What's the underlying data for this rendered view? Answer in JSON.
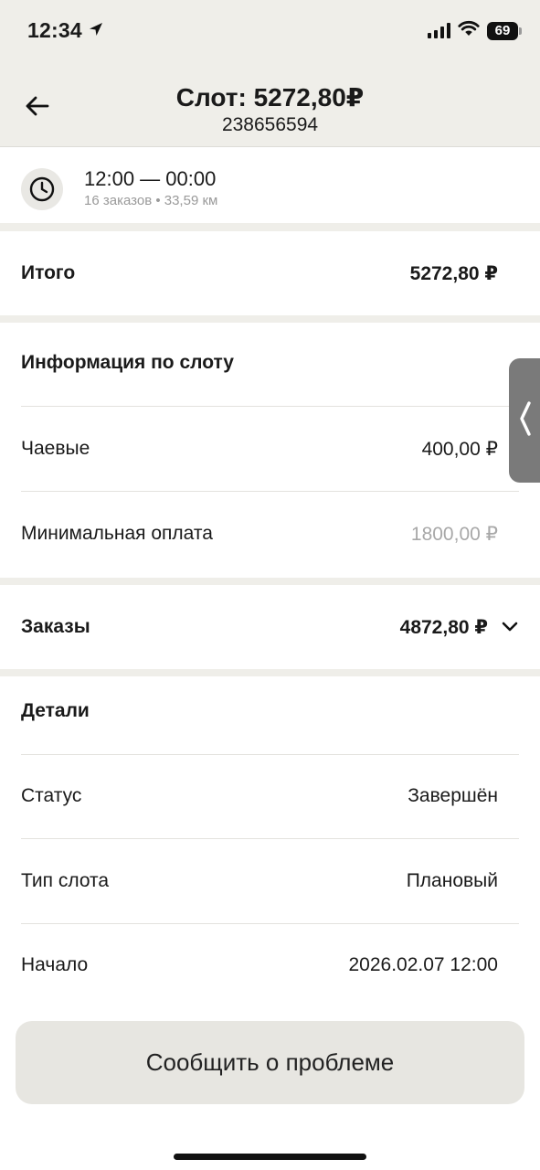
{
  "status_bar": {
    "time": "12:34",
    "battery": "69"
  },
  "header": {
    "title": "Слот: 5272,80₽",
    "subtitle": "238656594"
  },
  "slot_time": {
    "range": "12:00 — 00:00",
    "details": "16 заказов • 33,59 км"
  },
  "total": {
    "label": "Итого",
    "value": "5272,80 ₽"
  },
  "slot_info": {
    "heading": "Информация по слоту",
    "rows": [
      {
        "label": "Чаевые",
        "value": "400,00 ₽"
      },
      {
        "label": "Минимальная оплата",
        "value": "1800,00 ₽"
      }
    ]
  },
  "orders": {
    "label": "Заказы",
    "value": "4872,80 ₽"
  },
  "details": {
    "heading": "Детали",
    "rows": [
      {
        "label": "Статус",
        "value": "Завершён"
      },
      {
        "label": "Тип слота",
        "value": "Плановый"
      },
      {
        "label": "Начало",
        "value": "2026.02.07 12:00"
      }
    ]
  },
  "actions": {
    "report_label": "Сообщить о проблеме"
  },
  "icons": {
    "back": "arrow-left-icon",
    "clock": "clock-icon",
    "chevron": "chevron-down-icon",
    "handle": "chevron-left-icon",
    "location": "location-arrow-icon"
  }
}
